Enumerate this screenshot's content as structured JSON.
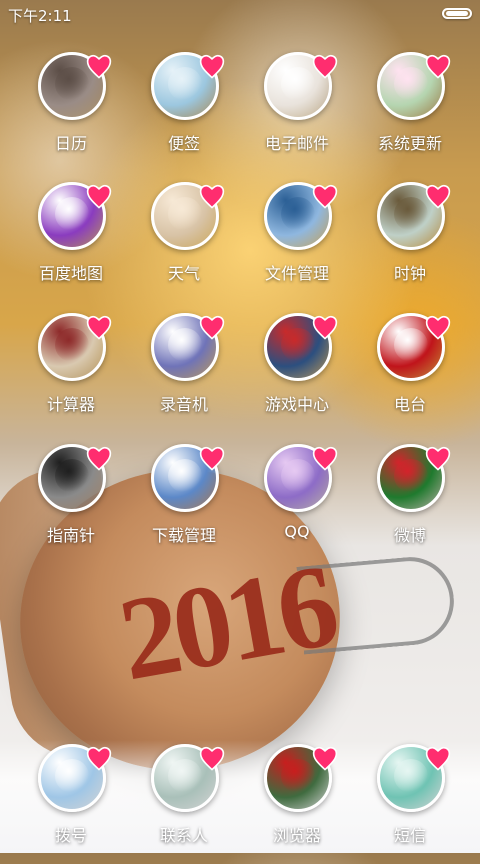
{
  "status_bar": {
    "time": "下午2:11"
  },
  "wallpaper": {
    "year_text": "2016"
  },
  "apps": [
    {
      "id": "calendar",
      "label": "日历",
      "bg": "#9a8c86",
      "accent": "#5c4e47"
    },
    {
      "id": "notes",
      "label": "便签",
      "bg": "#9cc7df",
      "accent": "#e6f2f8"
    },
    {
      "id": "email",
      "label": "电子邮件",
      "bg": "#e9e3dc",
      "accent": "#ffffff"
    },
    {
      "id": "system-update",
      "label": "系统更新",
      "bg": "#b5d5b0",
      "accent": "#ffe2f0"
    },
    {
      "id": "baidu-map",
      "label": "百度地图",
      "bg": "#8a3cbf",
      "accent": "#ffffff"
    },
    {
      "id": "weather",
      "label": "天气",
      "bg": "#d8c3a6",
      "accent": "#f7e9d6"
    },
    {
      "id": "file-manager",
      "label": "文件管理",
      "bg": "#8fb7df",
      "accent": "#2b5f95"
    },
    {
      "id": "clock",
      "label": "时钟",
      "bg": "#bfd0c7",
      "accent": "#6a5a3b"
    },
    {
      "id": "calculator",
      "label": "计算器",
      "bg": "#d9c9b0",
      "accent": "#8e2a2a"
    },
    {
      "id": "recorder",
      "label": "录音机",
      "bg": "#6f73b8",
      "accent": "#ffffff"
    },
    {
      "id": "game-center",
      "label": "游戏中心",
      "bg": "#2c4f7f",
      "accent": "#c92a2a"
    },
    {
      "id": "radio",
      "label": "电台",
      "bg": "#c0141b",
      "accent": "#ffffff"
    },
    {
      "id": "compass",
      "label": "指南针",
      "bg": "#8a8a8a",
      "accent": "#1f1f1f"
    },
    {
      "id": "download-manager",
      "label": "下载管理",
      "bg": "#5c88c8",
      "accent": "#ffffff"
    },
    {
      "id": "qq",
      "label": "QQ",
      "bg": "#8d6cc7",
      "accent": "#e6c9f2"
    },
    {
      "id": "weibo",
      "label": "微博",
      "bg": "#1f7a2e",
      "accent": "#d3232b"
    },
    {
      "id": "dialer",
      "label": "拨号",
      "bg": "#9fc6e6",
      "accent": "#ffffff"
    },
    {
      "id": "contacts",
      "label": "联系人",
      "bg": "#a9c0b9",
      "accent": "#f0f6f4"
    },
    {
      "id": "browser",
      "label": "浏览器",
      "bg": "#3f6b3f",
      "accent": "#c81e1e"
    },
    {
      "id": "sms",
      "label": "短信",
      "bg": "#6fc3b3",
      "accent": "#e6f6f2"
    }
  ]
}
